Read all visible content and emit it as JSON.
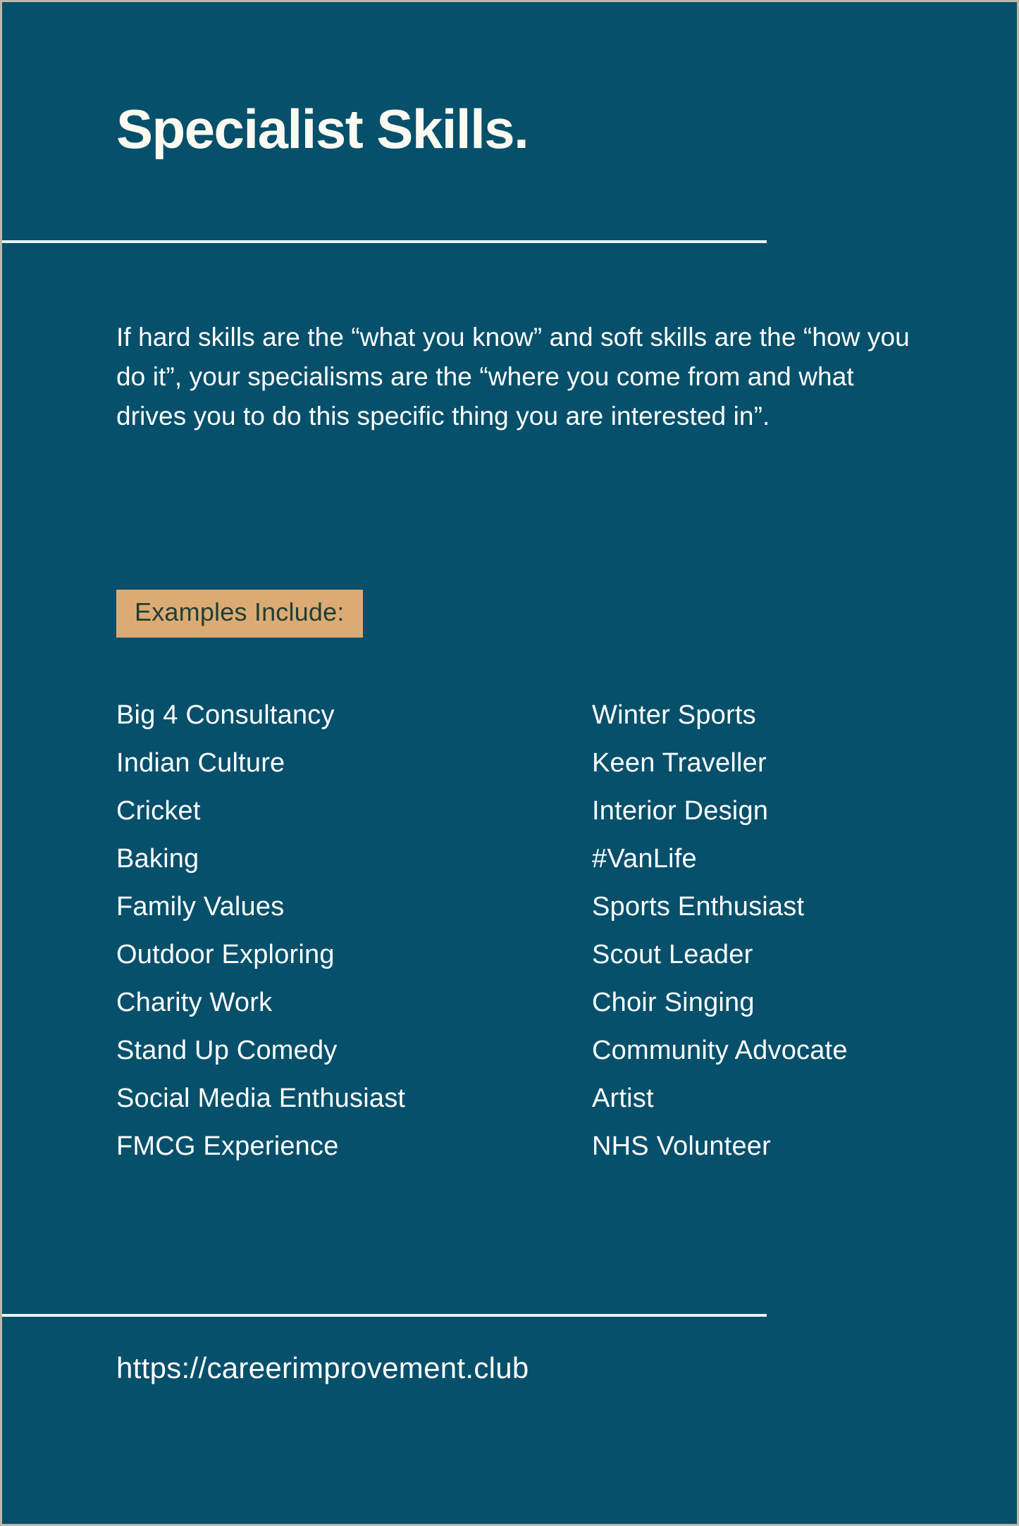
{
  "poster": {
    "background_color": "#06506b",
    "border_color": "#b9b9ac",
    "title": "Specialist Skills.",
    "intro_paragraph": "If hard skills are the “what you know” and soft skills are the “how you do it”, your specialisms are the “where you come from and what drives you to do this specific thing you are interested in”.",
    "badge": {
      "label": "Examples Include:",
      "background_color": "#dcab74",
      "text_color": "#1f3f33"
    },
    "examples": {
      "left_column": [
        "Big 4 Consultancy",
        "Indian Culture",
        "Cricket",
        "Baking",
        "Family Values",
        "Outdoor Exploring",
        "Charity Work",
        "Stand Up Comedy",
        "Social Media Enthusiast",
        "FMCG Experience"
      ],
      "right_column": [
        "Winter Sports",
        "Keen Traveller",
        "Interior Design",
        "#VanLife",
        "Sports Enthusiast",
        "Scout Leader",
        "Choir Singing",
        "Community Advocate",
        "Artist",
        "NHS Volunteer"
      ]
    },
    "footer": {
      "url": "https://careerimprovement.club"
    }
  }
}
